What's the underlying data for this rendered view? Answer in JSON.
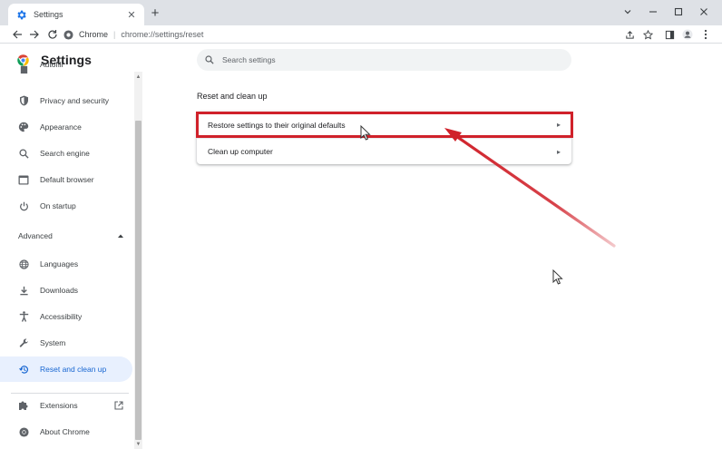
{
  "browser": {
    "tab": {
      "title": "Settings",
      "icon": "gear-icon"
    },
    "omnibox": {
      "site": "Chrome",
      "url": "chrome://settings/reset"
    },
    "toolbar_icons": [
      "back-icon",
      "forward-icon",
      "reload-icon",
      "share-icon",
      "bookmark-star-icon",
      "side-panel-icon",
      "profile-icon",
      "menu-icon"
    ]
  },
  "settings": {
    "title": "Settings",
    "search_placeholder": "Search settings",
    "sidebar": {
      "partial_item": "Autofill",
      "items": [
        {
          "label": "Privacy and security",
          "icon": "shield-icon"
        },
        {
          "label": "Appearance",
          "icon": "palette-icon"
        },
        {
          "label": "Search engine",
          "icon": "search-icon"
        },
        {
          "label": "Default browser",
          "icon": "browser-icon"
        },
        {
          "label": "On startup",
          "icon": "power-icon"
        }
      ],
      "advanced_label": "Advanced",
      "advanced_items": [
        {
          "label": "Languages",
          "icon": "globe-icon"
        },
        {
          "label": "Downloads",
          "icon": "download-icon"
        },
        {
          "label": "Accessibility",
          "icon": "accessibility-icon"
        },
        {
          "label": "System",
          "icon": "wrench-icon"
        },
        {
          "label": "Reset and clean up",
          "icon": "restore-icon",
          "active": true
        }
      ],
      "footer_items": [
        {
          "label": "Extensions",
          "icon": "puzzle-icon"
        },
        {
          "label": "About Chrome",
          "icon": "chrome-icon"
        }
      ]
    },
    "main": {
      "section_title": "Reset and clean up",
      "rows": [
        {
          "label": "Restore settings to their original defaults",
          "highlighted": true
        },
        {
          "label": "Clean up computer"
        }
      ]
    }
  },
  "colors": {
    "accent": "#1967d2",
    "active_bg": "#e8f0fe",
    "annotation": "#d0212a"
  }
}
